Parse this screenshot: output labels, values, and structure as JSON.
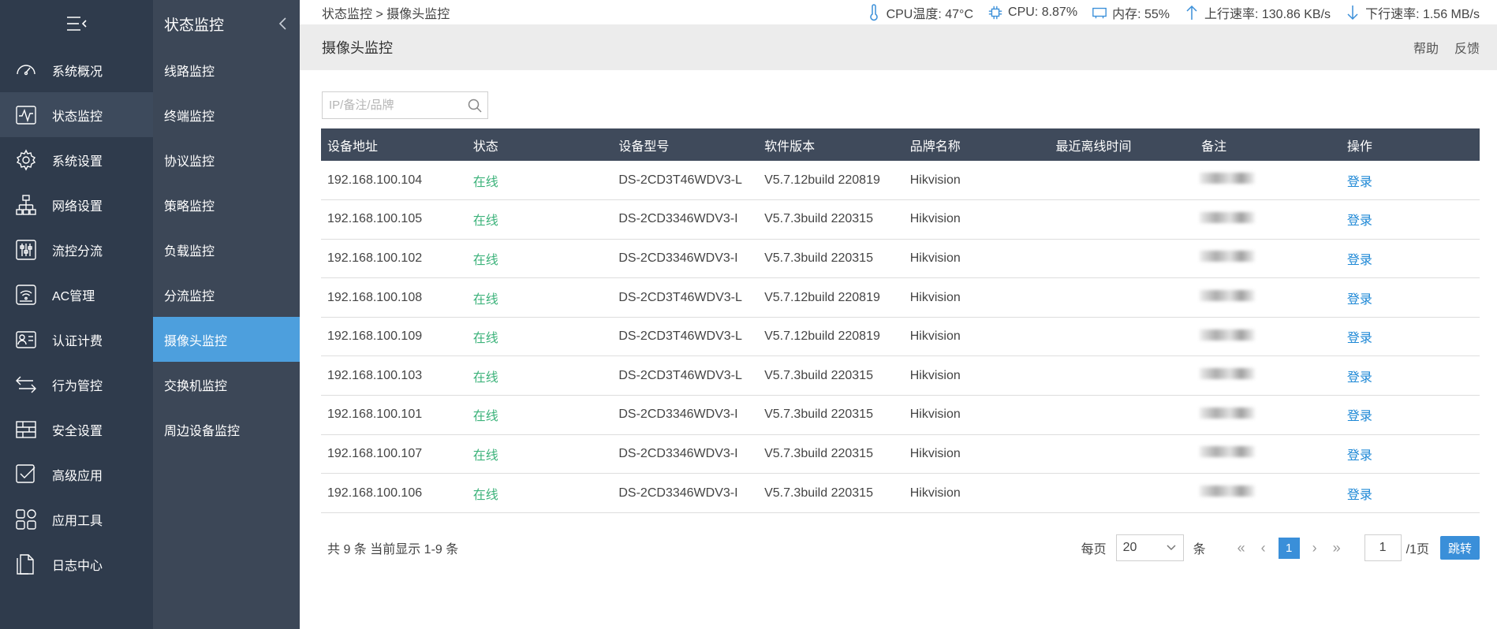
{
  "sidebar": {
    "items": [
      {
        "label": "系统概况",
        "icon": "dashboard-icon"
      },
      {
        "label": "状态监控",
        "icon": "pulse-icon"
      },
      {
        "label": "系统设置",
        "icon": "gear-icon"
      },
      {
        "label": "网络设置",
        "icon": "network-icon"
      },
      {
        "label": "流控分流",
        "icon": "sliders-icon"
      },
      {
        "label": "AC管理",
        "icon": "wifi-icon"
      },
      {
        "label": "认证计费",
        "icon": "id-card-icon"
      },
      {
        "label": "行为管控",
        "icon": "swap-icon"
      },
      {
        "label": "安全设置",
        "icon": "firewall-icon"
      },
      {
        "label": "高级应用",
        "icon": "checkbox-icon"
      },
      {
        "label": "应用工具",
        "icon": "apps-icon"
      },
      {
        "label": "日志中心",
        "icon": "document-icon"
      }
    ]
  },
  "subnav": {
    "title": "状态监控",
    "items": [
      "线路监控",
      "终端监控",
      "协议监控",
      "策略监控",
      "负载监控",
      "分流监控",
      "摄像头监控",
      "交换机监控",
      "周边设备监控"
    ]
  },
  "topbar": {
    "breadcrumb": "状态监控 > 摄像头监控",
    "cpu_temp": "CPU温度: 47°C",
    "cpu": "CPU: 8.87%",
    "memory": "内存: 55%",
    "upload": "上行速率: 130.86 KB/s",
    "download": "下行速率: 1.56 MB/s"
  },
  "page": {
    "title": "摄像头监控",
    "help": "帮助",
    "feedback": "反馈"
  },
  "search": {
    "placeholder": "IP/备注/品牌"
  },
  "table": {
    "headers": [
      "设备地址",
      "状态",
      "设备型号",
      "软件版本",
      "品牌名称",
      "最近离线时间",
      "备注",
      "操作"
    ],
    "rows": [
      {
        "ip": "192.168.100.104",
        "status": "在线",
        "model": "DS-2CD3T46WDV3-L",
        "version": "V5.7.12build 220819",
        "brand": "Hikvision",
        "offline": "",
        "action": "登录"
      },
      {
        "ip": "192.168.100.105",
        "status": "在线",
        "model": "DS-2CD3346WDV3-I",
        "version": "V5.7.3build 220315",
        "brand": "Hikvision",
        "offline": "",
        "action": "登录"
      },
      {
        "ip": "192.168.100.102",
        "status": "在线",
        "model": "DS-2CD3346WDV3-I",
        "version": "V5.7.3build 220315",
        "brand": "Hikvision",
        "offline": "",
        "action": "登录"
      },
      {
        "ip": "192.168.100.108",
        "status": "在线",
        "model": "DS-2CD3T46WDV3-L",
        "version": "V5.7.12build 220819",
        "brand": "Hikvision",
        "offline": "",
        "action": "登录"
      },
      {
        "ip": "192.168.100.109",
        "status": "在线",
        "model": "DS-2CD3T46WDV3-L",
        "version": "V5.7.12build 220819",
        "brand": "Hikvision",
        "offline": "",
        "action": "登录"
      },
      {
        "ip": "192.168.100.103",
        "status": "在线",
        "model": "DS-2CD3T46WDV3-L",
        "version": "V5.7.3build 220315",
        "brand": "Hikvision",
        "offline": "",
        "action": "登录"
      },
      {
        "ip": "192.168.100.101",
        "status": "在线",
        "model": "DS-2CD3346WDV3-I",
        "version": "V5.7.3build 220315",
        "brand": "Hikvision",
        "offline": "",
        "action": "登录"
      },
      {
        "ip": "192.168.100.107",
        "status": "在线",
        "model": "DS-2CD3346WDV3-I",
        "version": "V5.7.3build 220315",
        "brand": "Hikvision",
        "offline": "",
        "action": "登录"
      },
      {
        "ip": "192.168.100.106",
        "status": "在线",
        "model": "DS-2CD3346WDV3-I",
        "version": "V5.7.3build 220315",
        "brand": "Hikvision",
        "offline": "",
        "action": "登录"
      }
    ]
  },
  "pagination": {
    "summary": "共 9 条 当前显示 1-9 条",
    "per_page_label": "每页",
    "per_page": "20",
    "unit": "条",
    "current": "1",
    "page_input": "1",
    "total_pages": "/1页",
    "jump": "跳转"
  },
  "colors": {
    "sidebar": "#2f3b4c",
    "subnav": "#3c4757",
    "accent": "#4d9fdd",
    "online": "#3db37b",
    "link": "#1e88d6"
  }
}
